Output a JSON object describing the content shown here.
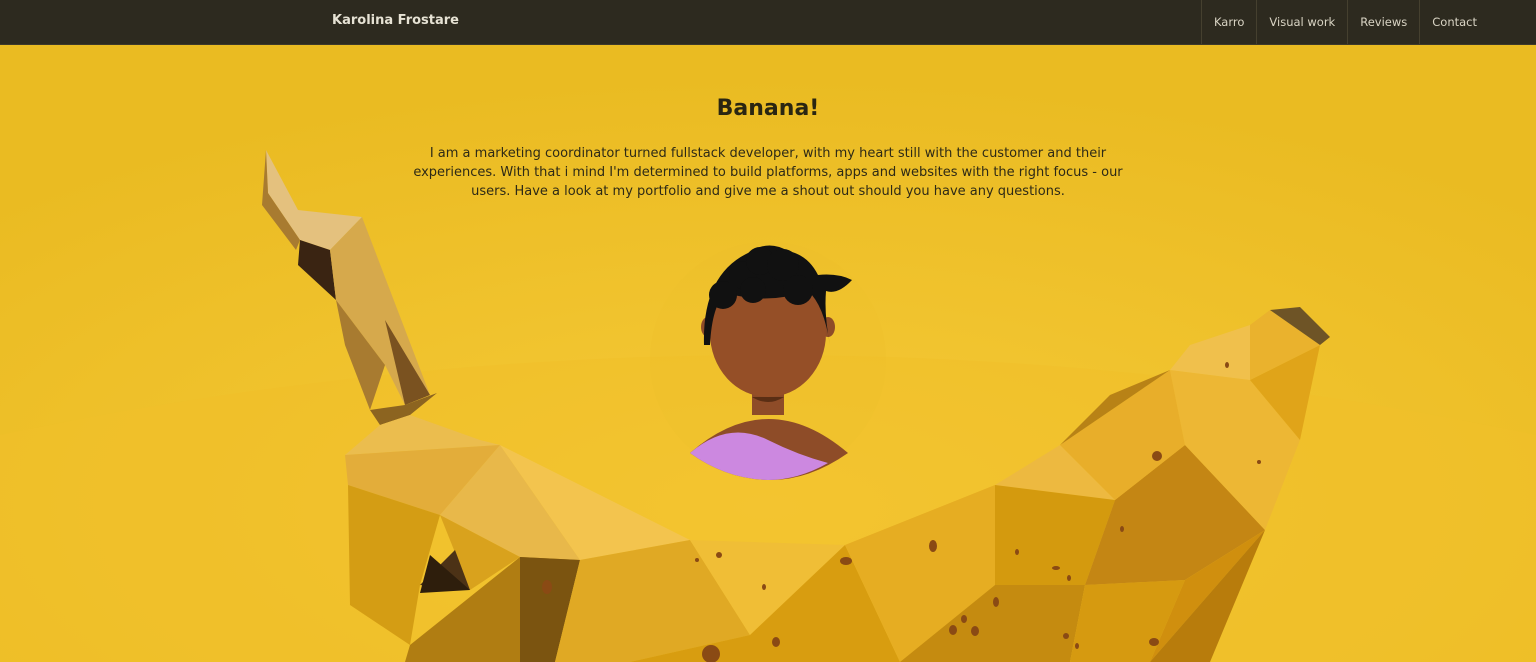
{
  "navbar": {
    "brand": "Karolina Frostare",
    "links": [
      {
        "label": "Karro"
      },
      {
        "label": "Visual work"
      },
      {
        "label": "Reviews"
      },
      {
        "label": "Contact"
      }
    ]
  },
  "hero": {
    "title": "Banana!",
    "intro": "I am a marketing coordinator turned fullstack developer, with my heart still with the customer and their experiences. With that i mind I'm determined to build platforms, apps and websites with the right focus - our users. Have a look at my portfolio and give me a shout out should you have any questions."
  },
  "colors": {
    "navbar_bg": "#2d2a1f",
    "page_bg": "#ecbc24",
    "text": "#2a2612"
  }
}
